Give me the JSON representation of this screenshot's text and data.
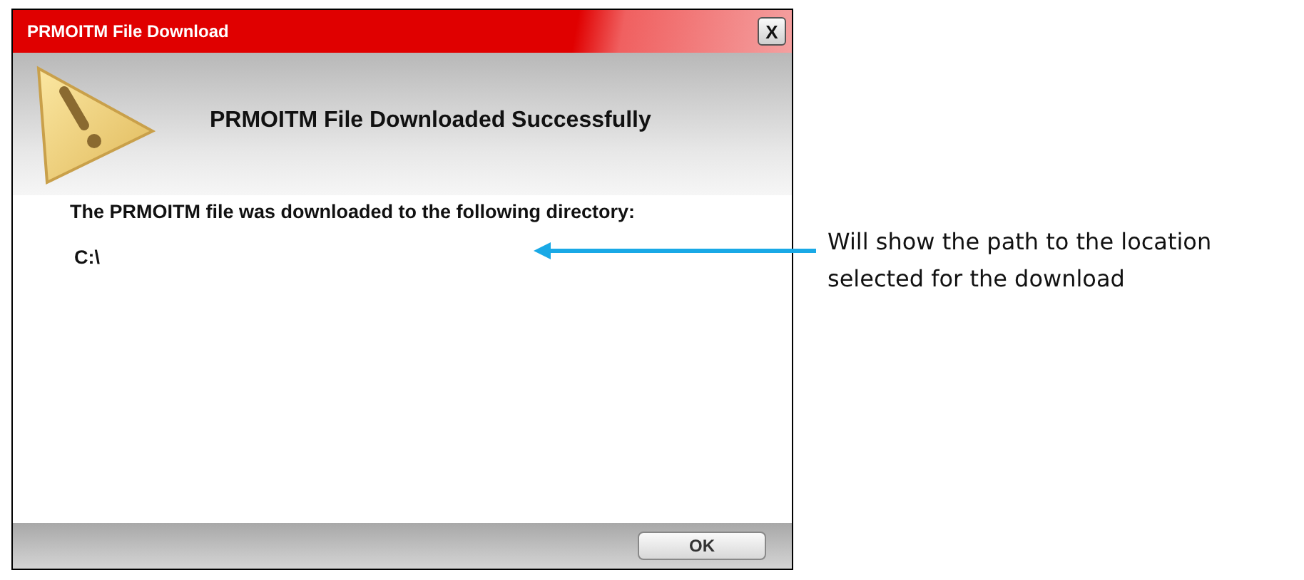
{
  "window": {
    "title": "PRMOITM File Download",
    "close": "X"
  },
  "header": {
    "heading": "PRMOITM File Downloaded Successfully"
  },
  "body": {
    "message": "The PRMOITM file was downloaded to the following directory:",
    "path": "C:\\"
  },
  "buttons": [
    "OK"
  ],
  "annotation": {
    "text": "Will show the path to the location selected for the download"
  }
}
